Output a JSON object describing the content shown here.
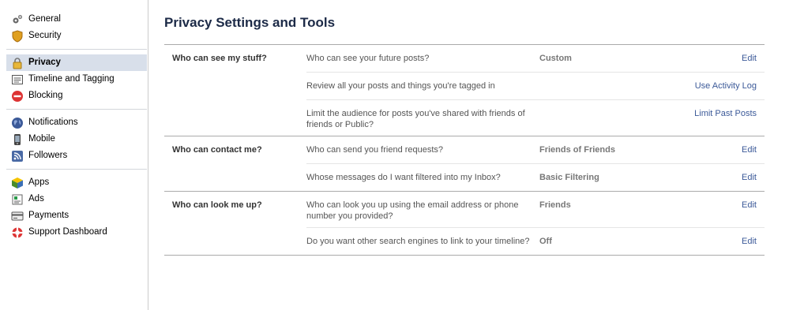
{
  "sidebar": {
    "groups": [
      [
        {
          "label": "General",
          "icon": "gears-icon"
        },
        {
          "label": "Security",
          "icon": "shield-icon"
        }
      ],
      [
        {
          "label": "Privacy",
          "icon": "lock-icon",
          "active": true
        },
        {
          "label": "Timeline and Tagging",
          "icon": "timeline-icon"
        },
        {
          "label": "Blocking",
          "icon": "blocking-icon"
        }
      ],
      [
        {
          "label": "Notifications",
          "icon": "globe-icon"
        },
        {
          "label": "Mobile",
          "icon": "mobile-icon"
        },
        {
          "label": "Followers",
          "icon": "rss-icon"
        }
      ],
      [
        {
          "label": "Apps",
          "icon": "apps-icon"
        },
        {
          "label": "Ads",
          "icon": "ads-icon"
        },
        {
          "label": "Payments",
          "icon": "card-icon"
        },
        {
          "label": "Support Dashboard",
          "icon": "lifebuoy-icon"
        }
      ]
    ]
  },
  "main": {
    "title": "Privacy Settings and Tools",
    "sections": [
      {
        "label": "Who can see my stuff?",
        "rows": [
          {
            "question": "Who can see your future posts?",
            "value": "Custom",
            "action": "Edit"
          },
          {
            "question": "Review all your posts and things you're tagged in",
            "value": "",
            "action": "Use Activity Log"
          },
          {
            "question": "Limit the audience for posts you've shared with friends of friends or Public?",
            "value": "",
            "action": "Limit Past Posts"
          }
        ]
      },
      {
        "label": "Who can contact me?",
        "rows": [
          {
            "question": "Who can send you friend requests?",
            "value": "Friends of Friends",
            "action": "Edit"
          },
          {
            "question": "Whose messages do I want filtered into my Inbox?",
            "value": "Basic Filtering",
            "action": "Edit"
          }
        ]
      },
      {
        "label": "Who can look me up?",
        "rows": [
          {
            "question": "Who can look you up using the email address or phone number you provided?",
            "value": "Friends",
            "action": "Edit"
          },
          {
            "question": "Do you want other search engines to link to your timeline?",
            "value": "Off",
            "action": "Edit"
          }
        ]
      }
    ]
  },
  "colors": {
    "link": "#3b5998",
    "active_bg": "#d8dfea",
    "title": "#1c2a47"
  }
}
